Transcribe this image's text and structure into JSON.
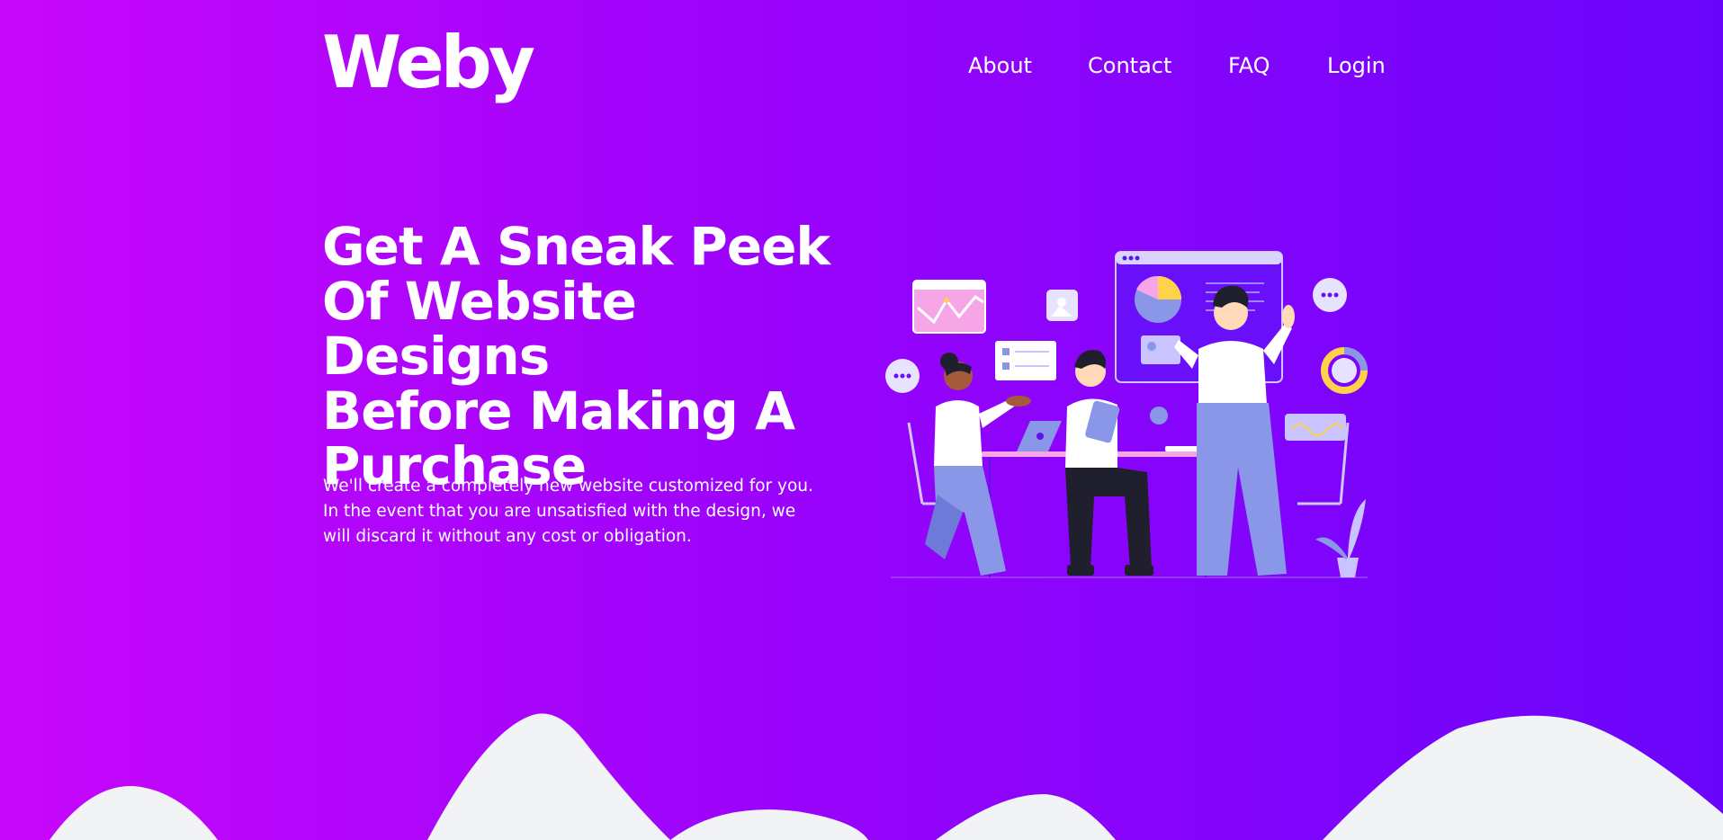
{
  "brand": {
    "logo": "Weby"
  },
  "nav": {
    "items": [
      {
        "label": "About"
      },
      {
        "label": "Contact"
      },
      {
        "label": "FAQ"
      },
      {
        "label": "Login"
      }
    ]
  },
  "hero": {
    "headline_lines": [
      "Get A Sneak Peek",
      "Of Website Designs",
      "Before Making A",
      "Purchase"
    ],
    "description_lines": [
      "We'll create a completely new website customized for you.",
      "In the event that you are unsatisfied with the design, we",
      "will discard it without any cost or obligation."
    ]
  },
  "theme": {
    "gradient_start": "#c707fb",
    "gradient_end": "#6a05fb",
    "wave_color": "#f2f3f5",
    "accent_periwinkle": "#8a96e8",
    "accent_pink": "#f6a6e6",
    "accent_yellow": "#ffd24a"
  },
  "illustration": {
    "icons": [
      "team-illustration",
      "browser-window-icon",
      "pie-chart-icon",
      "chat-bubble-icon",
      "image-icon",
      "checklist-icon",
      "donut-chart-icon",
      "laptop-icon",
      "plant-icon"
    ]
  }
}
